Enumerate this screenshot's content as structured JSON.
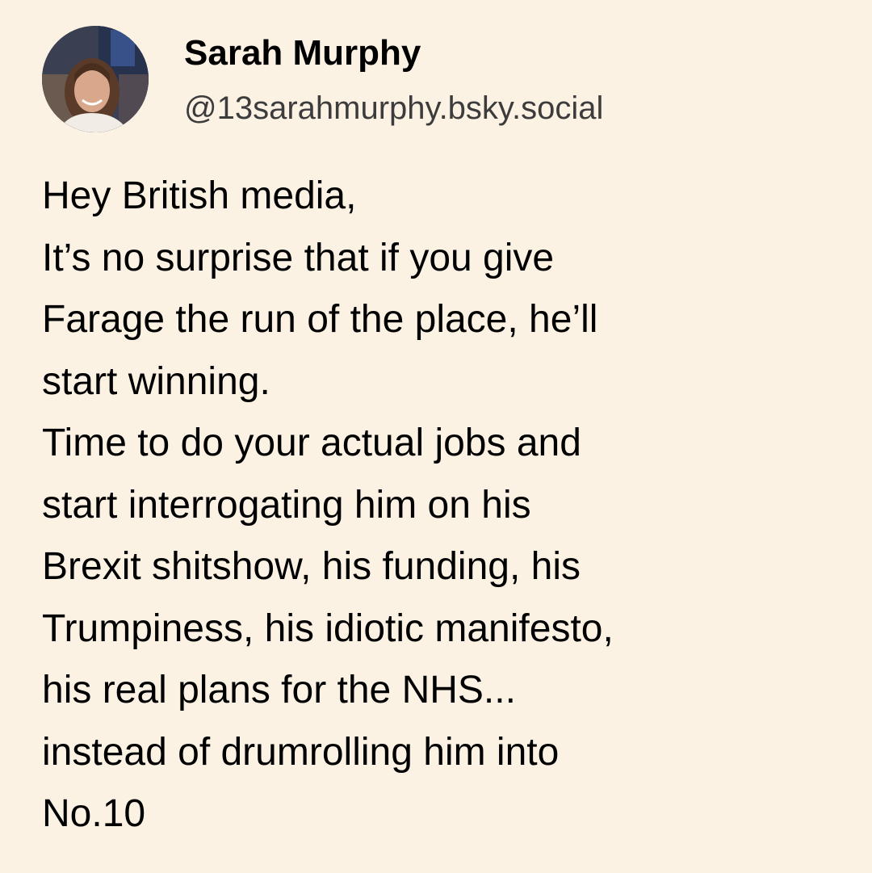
{
  "author": {
    "display_name": "Sarah Murphy",
    "handle": "@13sarahmurphy.bsky.social",
    "avatar_icon": "profile-photo"
  },
  "post": {
    "lines": [
      "Hey British media,",
      "It’s no surprise that if you give",
      "Farage the run of the place, he’ll",
      "start winning.",
      "Time to do your actual jobs and",
      "start interrogating him on his",
      "Brexit shitshow, his funding, his",
      "Trumpiness, his idiotic manifesto,",
      "his real plans for the NHS...",
      "instead of drumrolling him into",
      "No.10"
    ]
  },
  "colors": {
    "background": "#fcf2e4",
    "text": "#000000",
    "handle": "#3c3c3c"
  }
}
